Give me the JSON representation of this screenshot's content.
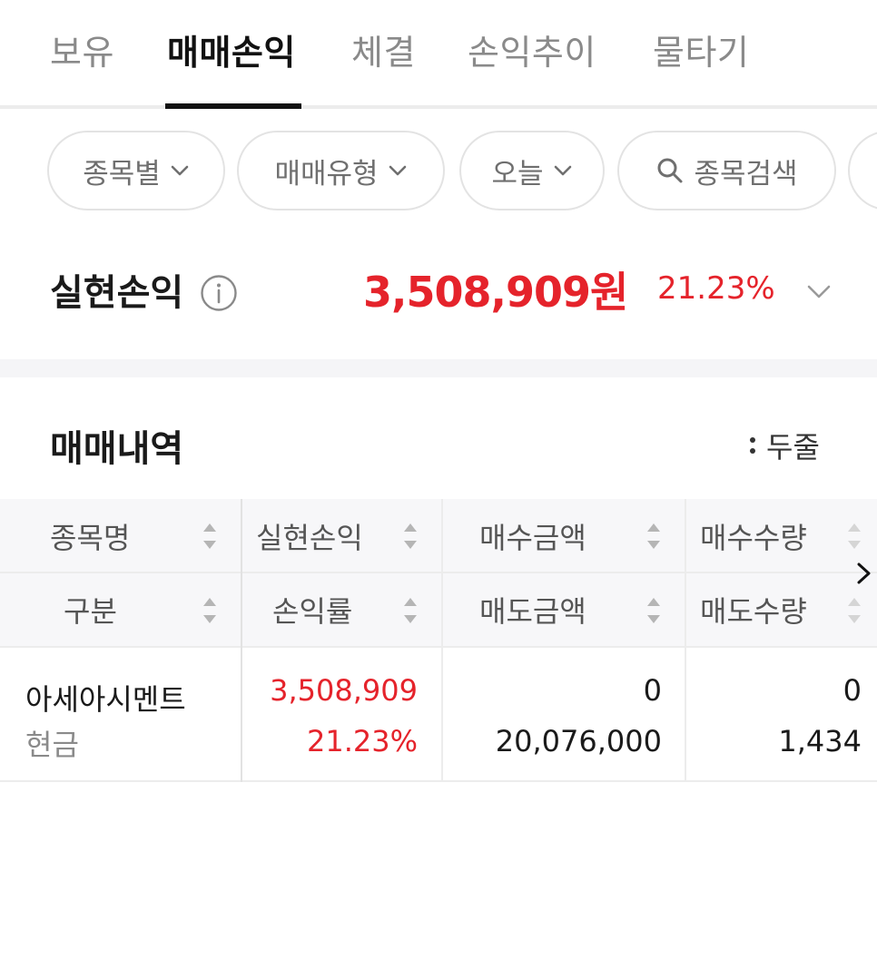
{
  "tabs": [
    {
      "label": "보유",
      "active": false
    },
    {
      "label": "매매손익",
      "active": true
    },
    {
      "label": "체결",
      "active": false
    },
    {
      "label": "손익추이",
      "active": false
    },
    {
      "label": "물타기",
      "active": false
    }
  ],
  "filters": {
    "by_stock": "종목별",
    "trade_type": "매매유형",
    "period": "오늘",
    "search": "종목검색"
  },
  "summary": {
    "title": "실현손익",
    "amount": "3,508,909원",
    "rate": "21.23%"
  },
  "history": {
    "title": "매매내역",
    "view_toggle": "두줄"
  },
  "table": {
    "headers_row1": [
      "종목명",
      "실현손익",
      "매수금액",
      "매수수량"
    ],
    "headers_row2": [
      "구분",
      "손익률",
      "매도금액",
      "매도수량"
    ],
    "rows": [
      {
        "stock_name": "아세아시멘트",
        "category": "현금",
        "realized_pnl": "3,508,909",
        "pnl_rate": "21.23%",
        "buy_amount": "0",
        "sell_amount": "20,076,000",
        "buy_qty": "0",
        "sell_qty": "1,434"
      }
    ]
  },
  "colors": {
    "accent_red": "#e5232b",
    "active_text": "#111111",
    "inactive_text": "#8a8a8a"
  }
}
